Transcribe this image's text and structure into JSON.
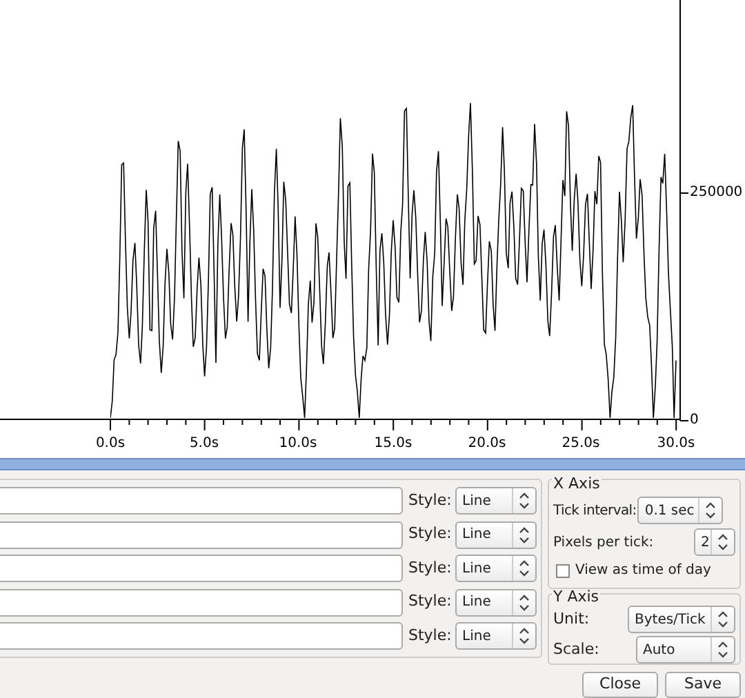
{
  "graph": {
    "y_tick_labels": [
      "250000",
      "0"
    ],
    "x_tick_labels": [
      "0.0s",
      "5.0s",
      "10.0s",
      "15.0s",
      "20.0s",
      "25.0s",
      "30.0s"
    ]
  },
  "graphs": [
    {
      "style_label": "Style:",
      "style": "Line"
    },
    {
      "style_label": "Style:",
      "style": "Line"
    },
    {
      "style_label": "Style:",
      "style": "Line"
    },
    {
      "style_label": "Style:",
      "style": "Line"
    },
    {
      "style_label": "Style:",
      "style": "Line"
    }
  ],
  "x_axis": {
    "title": "X Axis",
    "tick_interval_label": "Tick interval:",
    "tick_interval": "0.1 sec",
    "pixels_per_tick_label": "Pixels per tick:",
    "pixels_per_tick": "2",
    "time_of_day_label": "View as time of day",
    "time_of_day_checked": false
  },
  "y_axis": {
    "title": "Y Axis",
    "unit_label": "Unit:",
    "unit": "Bytes/Tick",
    "scale_label": "Scale:",
    "scale": "Auto"
  },
  "buttons": [
    {
      "label": "Close"
    },
    {
      "label": "Save"
    }
  ]
}
